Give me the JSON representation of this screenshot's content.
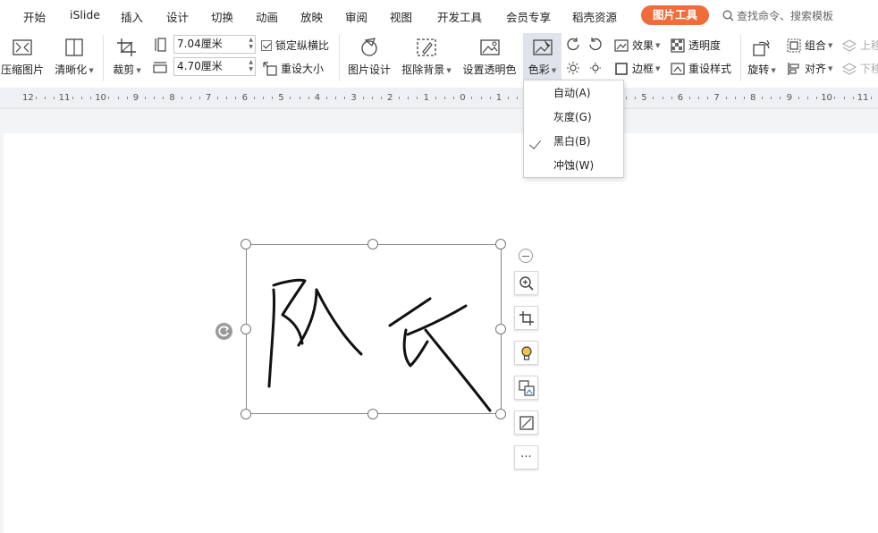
{
  "menu": {
    "tabs": [
      "开始",
      "iSlide",
      "插入",
      "设计",
      "切换",
      "动画",
      "放映",
      "审阅",
      "视图",
      "开发工具",
      "会员专享",
      "稻壳资源"
    ],
    "active_tab": "图片工具",
    "search_placeholder": "查找命令、搜索模板"
  },
  "ribbon": {
    "compress": "压缩图片",
    "sharpen": "清晰化",
    "crop": "裁剪",
    "width_value": "7.04厘米",
    "height_value": "4.70厘米",
    "lock_ratio": "锁定纵横比",
    "reset_size": "重设大小",
    "picture_design": "图片设计",
    "remove_bg": "抠除背景",
    "set_transparent": "设置透明色",
    "color": "色彩",
    "effects": "效果",
    "transparency": "透明度",
    "border": "边框",
    "reset_style": "重设样式",
    "rotate": "旋转",
    "group": "组合",
    "align": "对齐",
    "bring_up": "上移",
    "send_down": "下移"
  },
  "ruler": {
    "labels": [
      "12",
      "11",
      "10",
      "9",
      "8",
      "7",
      "6",
      "5",
      "4",
      "3",
      "2",
      "1",
      "0",
      "1",
      "2",
      "3",
      "4",
      "5",
      "6",
      "7",
      "8",
      "9",
      "10",
      "11"
    ]
  },
  "color_menu": {
    "items": [
      {
        "label": "自动(A)",
        "checked": false
      },
      {
        "label": "灰度(G)",
        "checked": false
      },
      {
        "label": "黑白(B)",
        "checked": true
      },
      {
        "label": "冲蚀(W)",
        "checked": false
      }
    ]
  },
  "picture": {
    "content": "handwritten signature image",
    "signature_text": "队长"
  },
  "side_toolbar": {
    "buttons": [
      "zoom-in",
      "crop",
      "idea",
      "replace-picture",
      "fill",
      "more"
    ],
    "more_label": "···"
  },
  "colors": {
    "accent": "#ef6d3b",
    "active_button_bg": "#dfe4ec",
    "page_bg": "#f3f4f6"
  }
}
